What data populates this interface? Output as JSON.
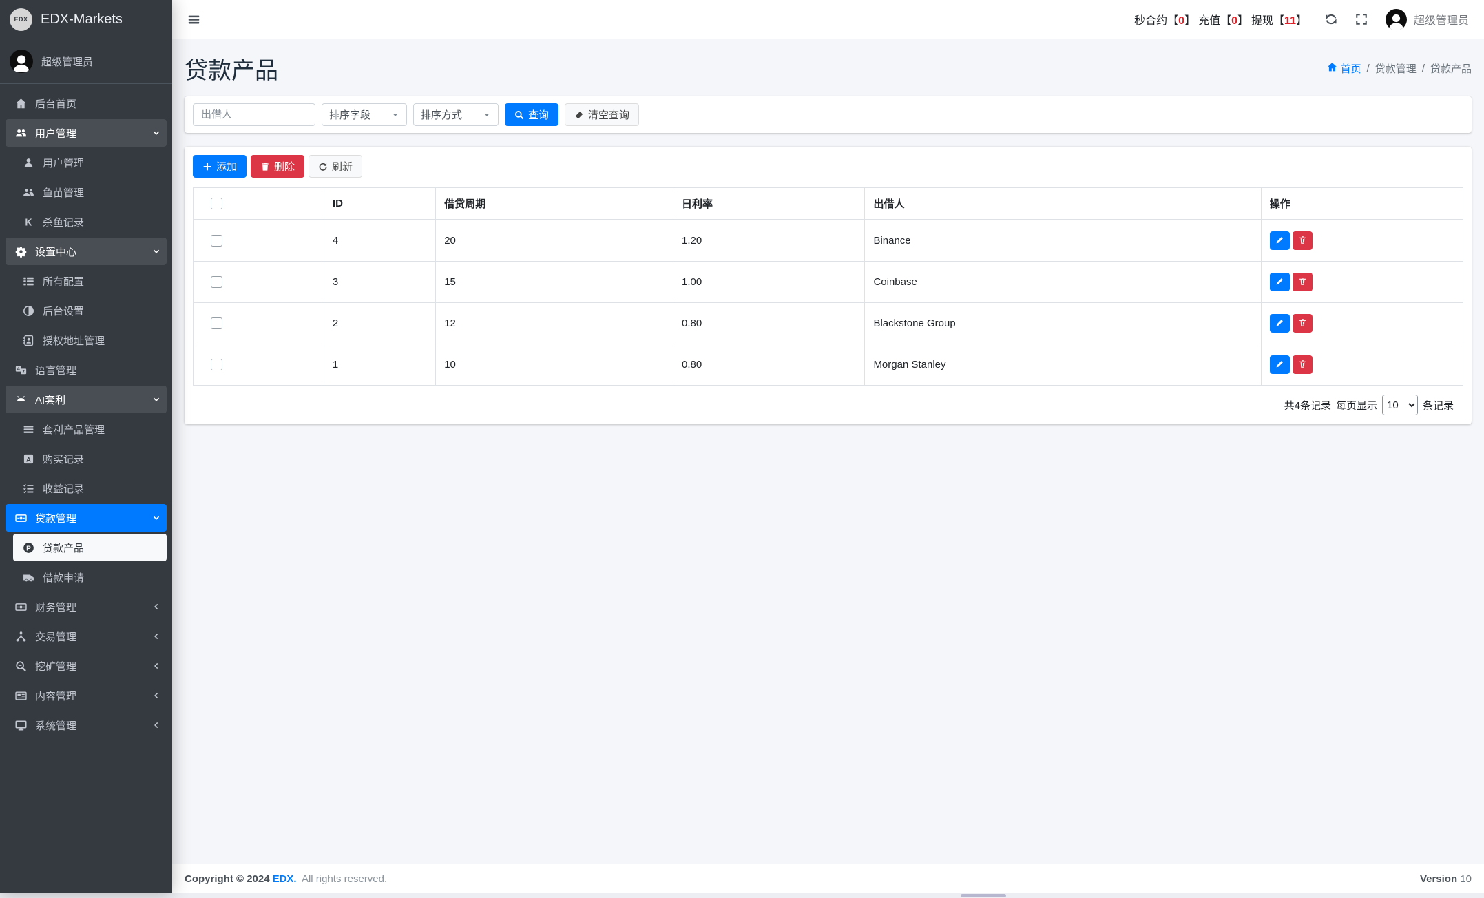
{
  "brand": {
    "logo_text": "EDX",
    "name": "EDX-Markets"
  },
  "user_panel": {
    "name": "超级管理员"
  },
  "sidebar": {
    "items": [
      {
        "slug": "dashboard",
        "icon": "home-icon",
        "label": "后台首页",
        "type": "link"
      },
      {
        "slug": "user-management",
        "icon": "users-icon",
        "label": "用户管理",
        "type": "tree",
        "state": "open",
        "children": [
          {
            "slug": "users",
            "icon": "user-icon",
            "label": "用户管理"
          },
          {
            "slug": "fry-management",
            "icon": "users-icon",
            "label": "鱼苗管理"
          },
          {
            "slug": "kill-fish-records",
            "icon": "kickstarter-k-icon",
            "label": "杀鱼记录"
          }
        ]
      },
      {
        "slug": "settings-center",
        "icon": "gear-icon",
        "label": "设置中心",
        "type": "tree",
        "state": "open",
        "children": [
          {
            "slug": "all-configs",
            "icon": "list-icon",
            "label": "所有配置"
          },
          {
            "slug": "backend-settings",
            "icon": "adjust-icon",
            "label": "后台设置"
          },
          {
            "slug": "auth-address-management",
            "icon": "address-book-icon",
            "label": "授权地址管理"
          }
        ]
      },
      {
        "slug": "language-management",
        "icon": "language-icon",
        "label": "语言管理",
        "type": "link"
      },
      {
        "slug": "ai-arbitrage",
        "icon": "android-icon",
        "label": "AI套利",
        "type": "tree",
        "state": "open",
        "children": [
          {
            "slug": "arbitrage-product-management",
            "icon": "bars-icon",
            "label": "套利产品管理"
          },
          {
            "slug": "purchase-records",
            "icon": "a-square-icon",
            "label": "购买记录"
          },
          {
            "slug": "profit-records",
            "icon": "tasks-icon",
            "label": "收益记录"
          }
        ]
      },
      {
        "slug": "loan-management",
        "icon": "money-bill-icon",
        "label": "贷款管理",
        "type": "tree",
        "state": "open",
        "active": true,
        "children": [
          {
            "slug": "loan-products",
            "icon": "p-circle-icon",
            "label": "贷款产品",
            "active": true
          },
          {
            "slug": "loan-applications",
            "icon": "van-icon",
            "label": "借款申请"
          }
        ]
      },
      {
        "slug": "finance-management",
        "icon": "money-bill-icon",
        "label": "财务管理",
        "type": "tree",
        "state": "closed"
      },
      {
        "slug": "trade-management",
        "icon": "branch-icon",
        "label": "交易管理",
        "type": "tree",
        "state": "closed"
      },
      {
        "slug": "mining-management",
        "icon": "search-minus-icon",
        "label": "挖矿管理",
        "type": "tree",
        "state": "closed"
      },
      {
        "slug": "content-management",
        "icon": "newspaper-icon",
        "label": "内容管理",
        "type": "tree",
        "state": "closed"
      },
      {
        "slug": "system-management",
        "icon": "desktop-icon",
        "label": "系统管理",
        "type": "tree",
        "state": "closed"
      }
    ]
  },
  "navbar": {
    "stats": [
      {
        "label": "秒合约",
        "value": "0"
      },
      {
        "label": "充值",
        "value": "0"
      },
      {
        "label": "提现",
        "value": "11"
      }
    ],
    "user_name": "超级管理员"
  },
  "page": {
    "title": "贷款产品",
    "breadcrumb": {
      "home": "首页",
      "items": [
        "贷款管理",
        "贷款产品"
      ]
    }
  },
  "filters": {
    "lender_placeholder": "出借人",
    "sort_field_label": "排序字段",
    "sort_order_label": "排序方式",
    "search_label": "查询",
    "clear_label": "清空查询"
  },
  "toolbar": {
    "add_label": "添加",
    "delete_label": "删除",
    "refresh_label": "刷新"
  },
  "table": {
    "columns": [
      "ID",
      "借贷周期",
      "日利率",
      "出借人",
      "操作"
    ],
    "rows": [
      {
        "id": "4",
        "period": "20",
        "rate": "1.20",
        "lender": "Binance"
      },
      {
        "id": "3",
        "period": "15",
        "rate": "1.00",
        "lender": "Coinbase"
      },
      {
        "id": "2",
        "period": "12",
        "rate": "0.80",
        "lender": "Blackstone Group"
      },
      {
        "id": "1",
        "period": "10",
        "rate": "0.80",
        "lender": "Morgan Stanley"
      }
    ]
  },
  "pagination": {
    "total_text": "共4条记录",
    "per_page_label": "每页显示",
    "per_page_value": "10",
    "suffix": "条记录"
  },
  "footer": {
    "copyright_prefix": "Copyright © 2024",
    "brand": "EDX.",
    "copyright_suffix": "All rights reserved.",
    "version_label": "Version",
    "version_value": "10"
  },
  "colors": {
    "accent": "#007bff",
    "danger": "#dc3545",
    "sidebar_bg": "#343a40",
    "content_bg": "#f4f6f9",
    "stat_number": "#e01e26"
  }
}
